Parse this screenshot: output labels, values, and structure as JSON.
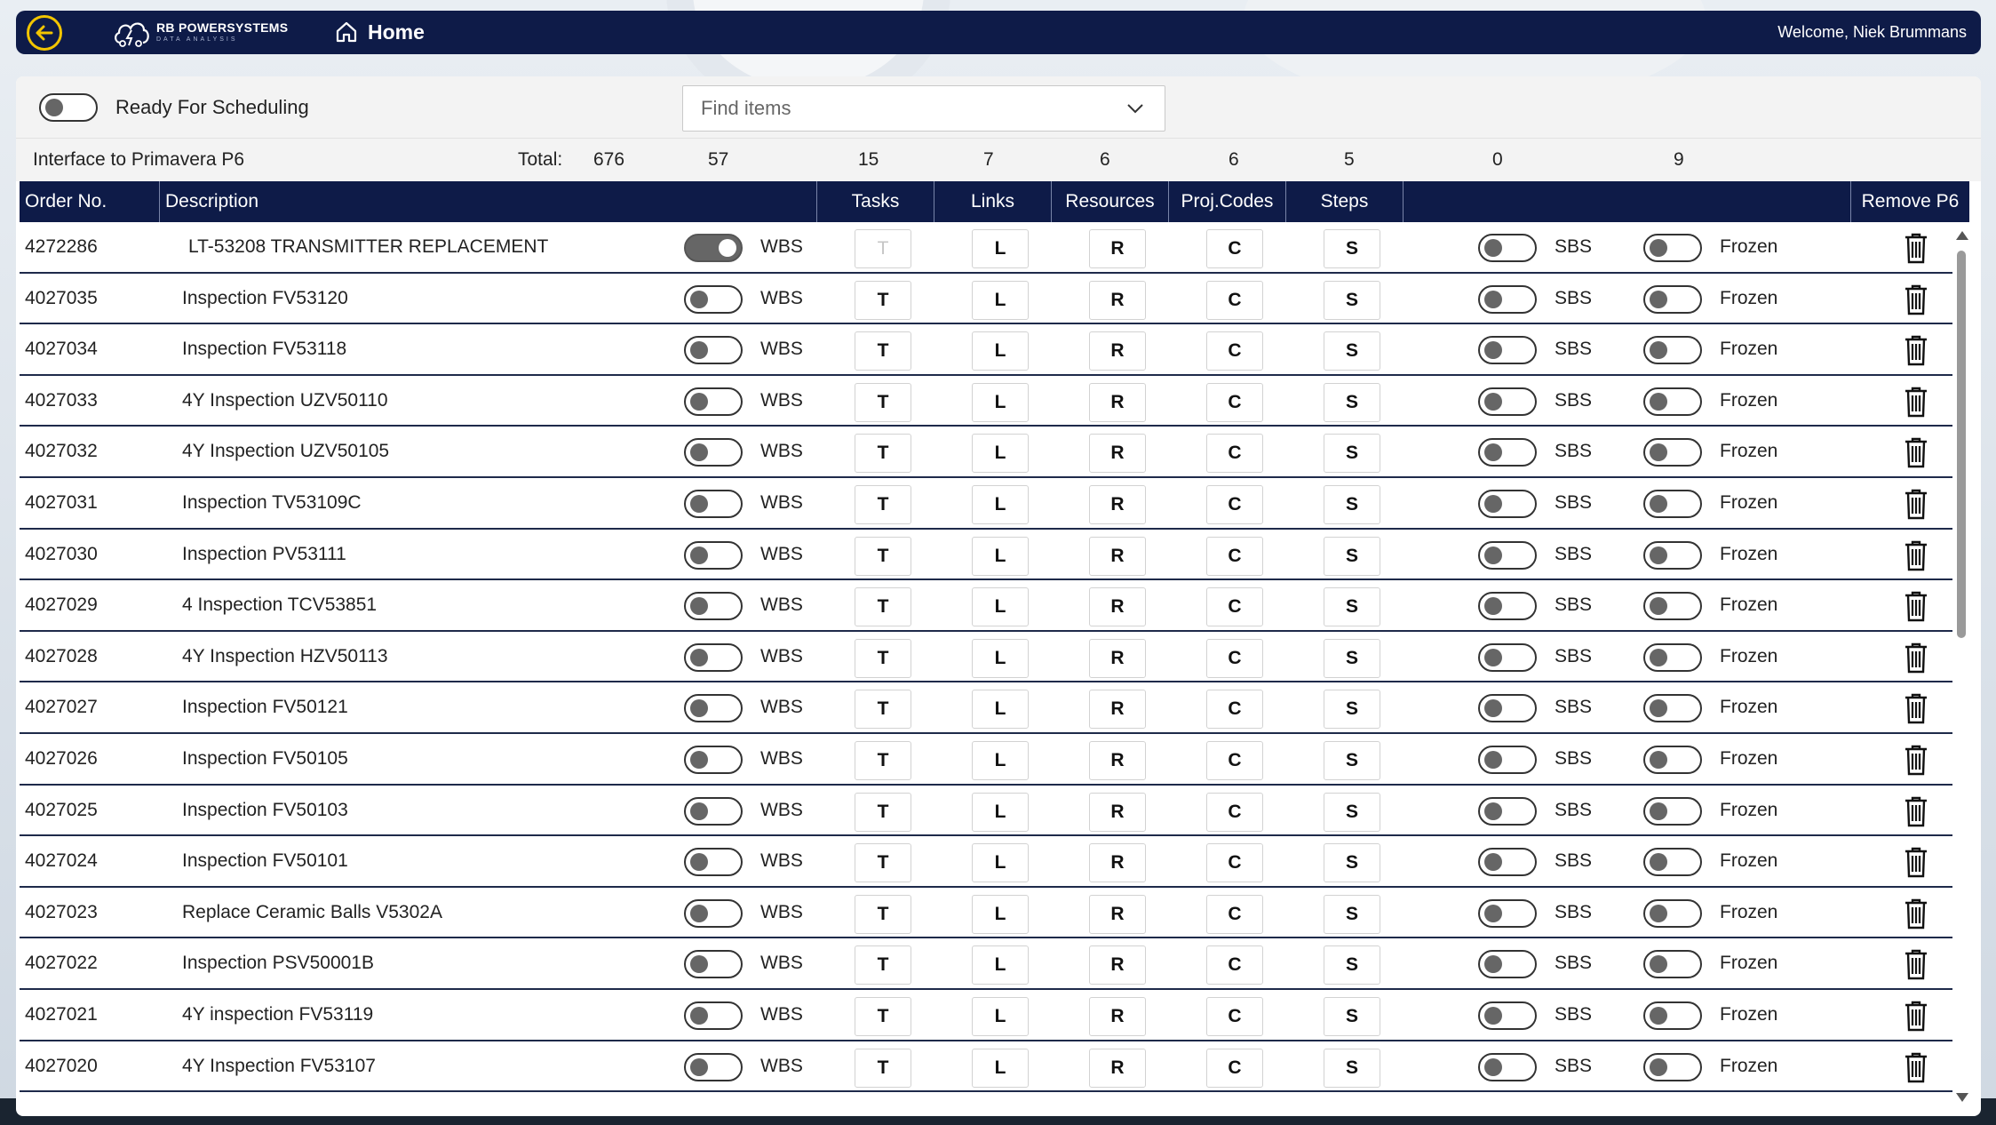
{
  "header": {
    "logo_name": "RB POWERSYSTEMS",
    "logo_sub": "DATA ANALYSIS",
    "home_label": "Home",
    "welcome": "Welcome, Niek Brummans",
    "accent": "#f2c500",
    "bar_color": "#0e1b48"
  },
  "controls": {
    "ready_label": "Ready For Scheduling",
    "ready_on": false,
    "find_placeholder": "Find items"
  },
  "totals": {
    "interface_label": "Interface to Primavera P6",
    "total_label": "Total:",
    "values": [
      "676",
      "57",
      "15",
      "7",
      "6",
      "6",
      "5",
      "0",
      "9"
    ]
  },
  "columns": {
    "order": "Order No.",
    "description": "Description",
    "tasks": "Tasks",
    "links": "Links",
    "resources": "Resources",
    "projcodes": "Proj.Codes",
    "steps": "Steps",
    "remove": "Remove P6"
  },
  "labels": {
    "wbs": "WBS",
    "sbs": "SBS",
    "frozen": "Frozen",
    "t": "T",
    "l": "L",
    "r": "R",
    "c": "C",
    "s": "S"
  },
  "rows": [
    {
      "order": "4272286",
      "desc": "LT-53208 TRANSMITTER REPLACEMENT",
      "wbs_on": true,
      "tasks_dim": true
    },
    {
      "order": "4027035",
      "desc": "Inspection FV53120",
      "wbs_on": false,
      "tasks_dim": false
    },
    {
      "order": "4027034",
      "desc": "Inspection FV53118",
      "wbs_on": false,
      "tasks_dim": false
    },
    {
      "order": "4027033",
      "desc": "4Y Inspection UZV50110",
      "wbs_on": false,
      "tasks_dim": false
    },
    {
      "order": "4027032",
      "desc": "4Y Inspection UZV50105",
      "wbs_on": false,
      "tasks_dim": false
    },
    {
      "order": "4027031",
      "desc": "Inspection TV53109C",
      "wbs_on": false,
      "tasks_dim": false
    },
    {
      "order": "4027030",
      "desc": "Inspection PV53111",
      "wbs_on": false,
      "tasks_dim": false
    },
    {
      "order": "4027029",
      "desc": "4 Inspection TCV53851",
      "wbs_on": false,
      "tasks_dim": false
    },
    {
      "order": "4027028",
      "desc": "4Y Inspection HZV50113",
      "wbs_on": false,
      "tasks_dim": false
    },
    {
      "order": "4027027",
      "desc": "Inspection FV50121",
      "wbs_on": false,
      "tasks_dim": false
    },
    {
      "order": "4027026",
      "desc": "Inspection FV50105",
      "wbs_on": false,
      "tasks_dim": false
    },
    {
      "order": "4027025",
      "desc": "Inspection FV50103",
      "wbs_on": false,
      "tasks_dim": false
    },
    {
      "order": "4027024",
      "desc": "Inspection FV50101",
      "wbs_on": false,
      "tasks_dim": false
    },
    {
      "order": "4027023",
      "desc": "Replace Ceramic Balls V5302A",
      "wbs_on": false,
      "tasks_dim": false
    },
    {
      "order": "4027022",
      "desc": "Inspection PSV50001B",
      "wbs_on": false,
      "tasks_dim": false
    },
    {
      "order": "4027021",
      "desc": "4Y inspection FV53119",
      "wbs_on": false,
      "tasks_dim": false
    },
    {
      "order": "4027020",
      "desc": "4Y Inspection FV53107",
      "wbs_on": false,
      "tasks_dim": false
    }
  ]
}
